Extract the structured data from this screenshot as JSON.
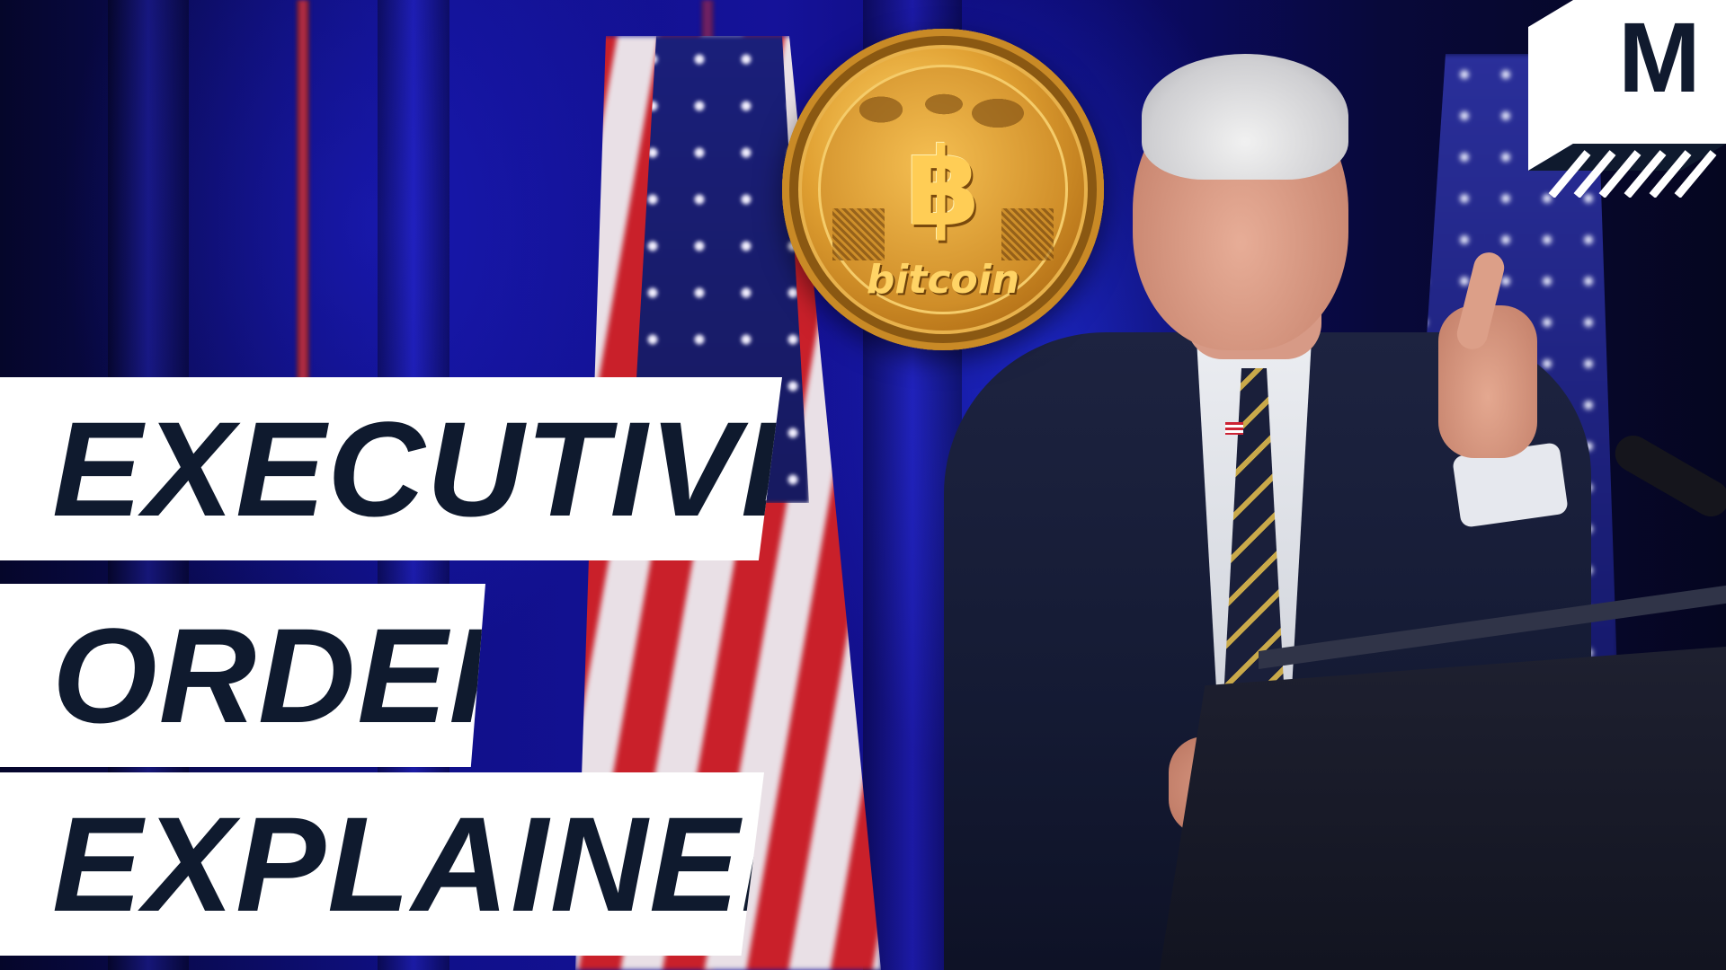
{
  "headline": {
    "line1": "EXECUTIVE",
    "line2": "ORDER",
    "line3": "EXPLAINED"
  },
  "coin": {
    "symbol": "฿",
    "label": "bitcoin",
    "icon": "bitcoin-coin-icon"
  },
  "logo": {
    "letter": "M",
    "icon": "mashable-logo-icon"
  },
  "colors": {
    "headline_bg": "#ffffff",
    "headline_text": "#0f1a2e",
    "coin_gold": "#e0a032",
    "backdrop_blue": "#151299"
  }
}
